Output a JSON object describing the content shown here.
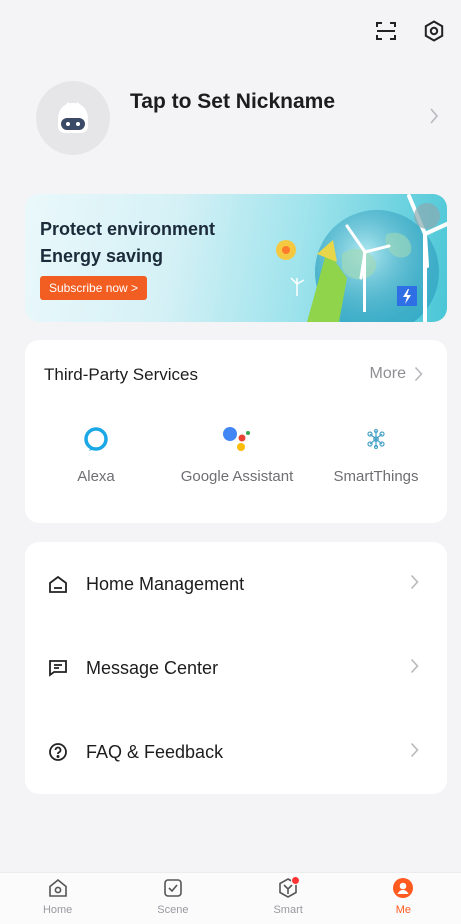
{
  "profile": {
    "nickname_prompt": "Tap to Set Nickname"
  },
  "banner": {
    "line1": "Protect environment",
    "line2": "Energy saving",
    "button": "Subscribe now >"
  },
  "services": {
    "title": "Third-Party Services",
    "more": "More",
    "items": [
      {
        "label": "Alexa",
        "icon": "alexa-icon"
      },
      {
        "label": "Google Assistant",
        "icon": "google-assistant-icon"
      },
      {
        "label": "SmartThings",
        "icon": "smartthings-icon"
      }
    ]
  },
  "menu": [
    {
      "label": "Home Management",
      "icon": "home-icon"
    },
    {
      "label": "Message Center",
      "icon": "message-icon"
    },
    {
      "label": "FAQ & Feedback",
      "icon": "question-icon"
    }
  ],
  "tabs": [
    {
      "label": "Home",
      "icon": "home-tab-icon"
    },
    {
      "label": "Scene",
      "icon": "scene-tab-icon"
    },
    {
      "label": "Smart",
      "icon": "smart-tab-icon"
    },
    {
      "label": "Me",
      "icon": "me-tab-icon",
      "active": true
    }
  ],
  "colors": {
    "accent": "#ff5a1f",
    "banner_button": "#f25d22"
  }
}
